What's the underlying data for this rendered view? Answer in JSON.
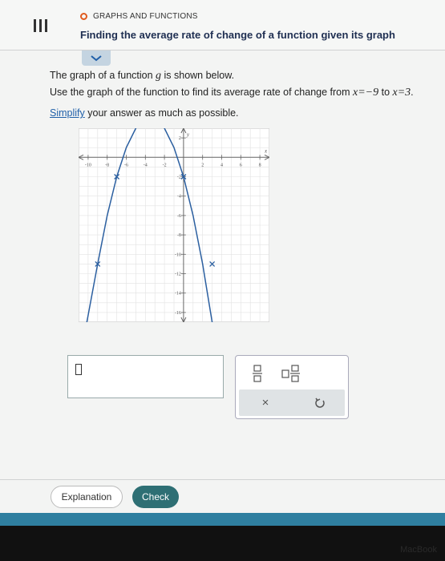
{
  "header": {
    "topic": "GRAPHS AND FUNCTIONS",
    "title": "Finding the average rate of change of a function given its graph"
  },
  "question": {
    "line1_pre": "The graph of a function ",
    "func": "g",
    "line1_post": " is shown below.",
    "line2_pre": "Use the graph of the function to find its average rate of change from ",
    "line2_expr1": "x=−9",
    "line2_mid": " to ",
    "line2_expr2": "x=3",
    "line2_post": ".",
    "simplify_link": "Simplify",
    "simplify_rest": " your answer as much as possible."
  },
  "chart_data": {
    "type": "line",
    "xlabel": "x",
    "ylabel": "y",
    "xlim": [
      -11,
      9
    ],
    "ylim": [
      -17,
      3
    ],
    "x_ticks": [
      "-10",
      "-8",
      "-6",
      "-4",
      "-2",
      "2",
      "4",
      "6",
      "8"
    ],
    "y_ticks": [
      "2",
      "-2",
      "-4",
      "-6",
      "-8",
      "-10",
      "-12",
      "-14",
      "-16"
    ],
    "series": [
      {
        "x": [
          -10.2,
          -9,
          -8,
          -7,
          -6,
          -5,
          -4,
          -3,
          -2,
          -1,
          0,
          1,
          2,
          3,
          3.5
        ],
        "y": [
          -17.36,
          -11,
          -6,
          -2,
          1,
          3,
          4,
          4,
          3,
          1,
          -2,
          -6,
          -11,
          -17,
          -20.5
        ]
      }
    ],
    "marked_points": [
      [
        -9,
        -11
      ],
      [
        -7,
        -2
      ],
      [
        -4,
        4
      ],
      [
        0,
        -2
      ],
      [
        3,
        -11
      ]
    ]
  },
  "answer": {
    "value": ""
  },
  "keypad": {
    "fraction_label": "fraction",
    "mixed_label": "mixed number",
    "clear_label": "×",
    "undo_label": "undo"
  },
  "buttons": {
    "explanation": "Explanation",
    "check": "Check"
  },
  "device": {
    "brand": "MacBook"
  }
}
